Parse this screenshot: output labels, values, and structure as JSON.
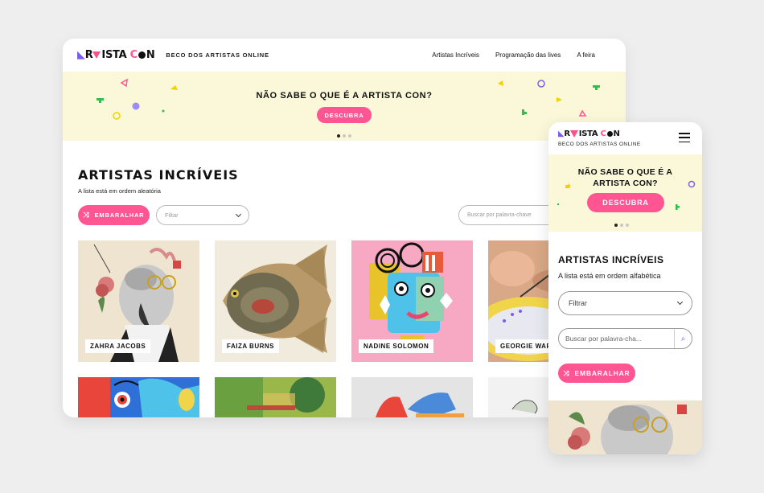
{
  "brand": {
    "logo_text": "ARTISTA CON",
    "tagline": "BECO DOS ARTISTAS ONLINE",
    "colors": {
      "pink": "#ff5592",
      "purple": "#7b5cf0",
      "banner": "#fbf8d9",
      "green": "#2fbf4f",
      "yellow": "#f5d000"
    }
  },
  "desktop": {
    "nav": [
      "Artistas Incríveis",
      "Programação das lives",
      "A feira"
    ],
    "banner": {
      "question": "NÃO SABE O QUE É A ARTISTA CON?",
      "button": "DESCUBRA"
    },
    "section_title": "ARTISTAS INCRÍVEIS",
    "section_subtitle": "A lista está em ordem aleatória",
    "shuffle_button": "EMBARALHAR",
    "shuffle_icon": "shuffle-icon",
    "filter_placeholder": "Filtar",
    "search_placeholder": "Buscar por palavra-chave",
    "artists": [
      "ZAHRA JACOBS",
      "FAIZA BURNS",
      "NADINE SOLOMON",
      "GEORGIE WAR"
    ]
  },
  "mobile": {
    "banner": {
      "question": "NÃO SABE O QUE É A ARTISTA CON?",
      "button": "DESCUBRA"
    },
    "section_title": "ARTISTAS INCRÍVEIS",
    "section_subtitle": "A lista está em ordem alfabética",
    "filter_label": "Filtrar",
    "search_placeholder": "Buscar por palavra-cha...",
    "shuffle_button": "EMBARALHAR",
    "menu_icon": "hamburger-icon",
    "search_icon": "search-icon"
  }
}
